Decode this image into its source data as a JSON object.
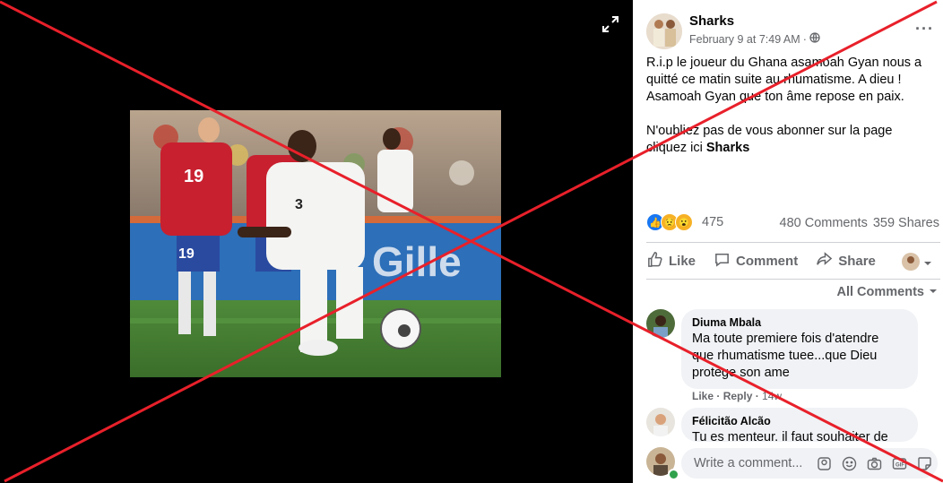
{
  "post": {
    "page_name": "Sharks",
    "timestamp": "February 9 at 7:49 AM",
    "separator": "·",
    "visibility_icon": "globe-icon",
    "text_lines": [
      "R.i.p le joueur du Ghana asamoah Gyan nous a",
      "quitté ce matin suite au rhumatisme. A dieu !",
      "Asamoah Gyan que ton âme repose en paix."
    ],
    "text_lines_2": [
      "N'oubliez pas de vous abonner sur la page",
      "cliquez ici"
    ],
    "link_text": "Sharks"
  },
  "stats": {
    "reactions_count": "475",
    "reaction_icons": [
      "like-icon",
      "sad-icon",
      "wow-icon"
    ],
    "comments": "480 Comments",
    "shares": "359 Shares"
  },
  "actions": {
    "like": "Like",
    "comment": "Comment",
    "share": "Share"
  },
  "comments_filter": "All Comments",
  "comments": [
    {
      "name": "Diuma Mbala",
      "text_lines": [
        "Ma toute premiere fois d'atendre",
        "que rhumatisme tuee...que Dieu",
        "protège son ame"
      ],
      "like": "Like",
      "reply": "Reply",
      "time": "14w"
    },
    {
      "name": "Félicitão Alcão",
      "text_lines": [
        "Tu es menteur. il faut souhaiter de"
      ]
    }
  ],
  "composer": {
    "placeholder": "Write a comment..."
  },
  "photo": {
    "jersey_numbers": [
      "19",
      "19",
      "3"
    ]
  },
  "colors": {
    "overlay_cross": "#e8202a",
    "secondary_text": "#65676b",
    "bubble": "#f0f2f5",
    "online": "#31a24c"
  }
}
